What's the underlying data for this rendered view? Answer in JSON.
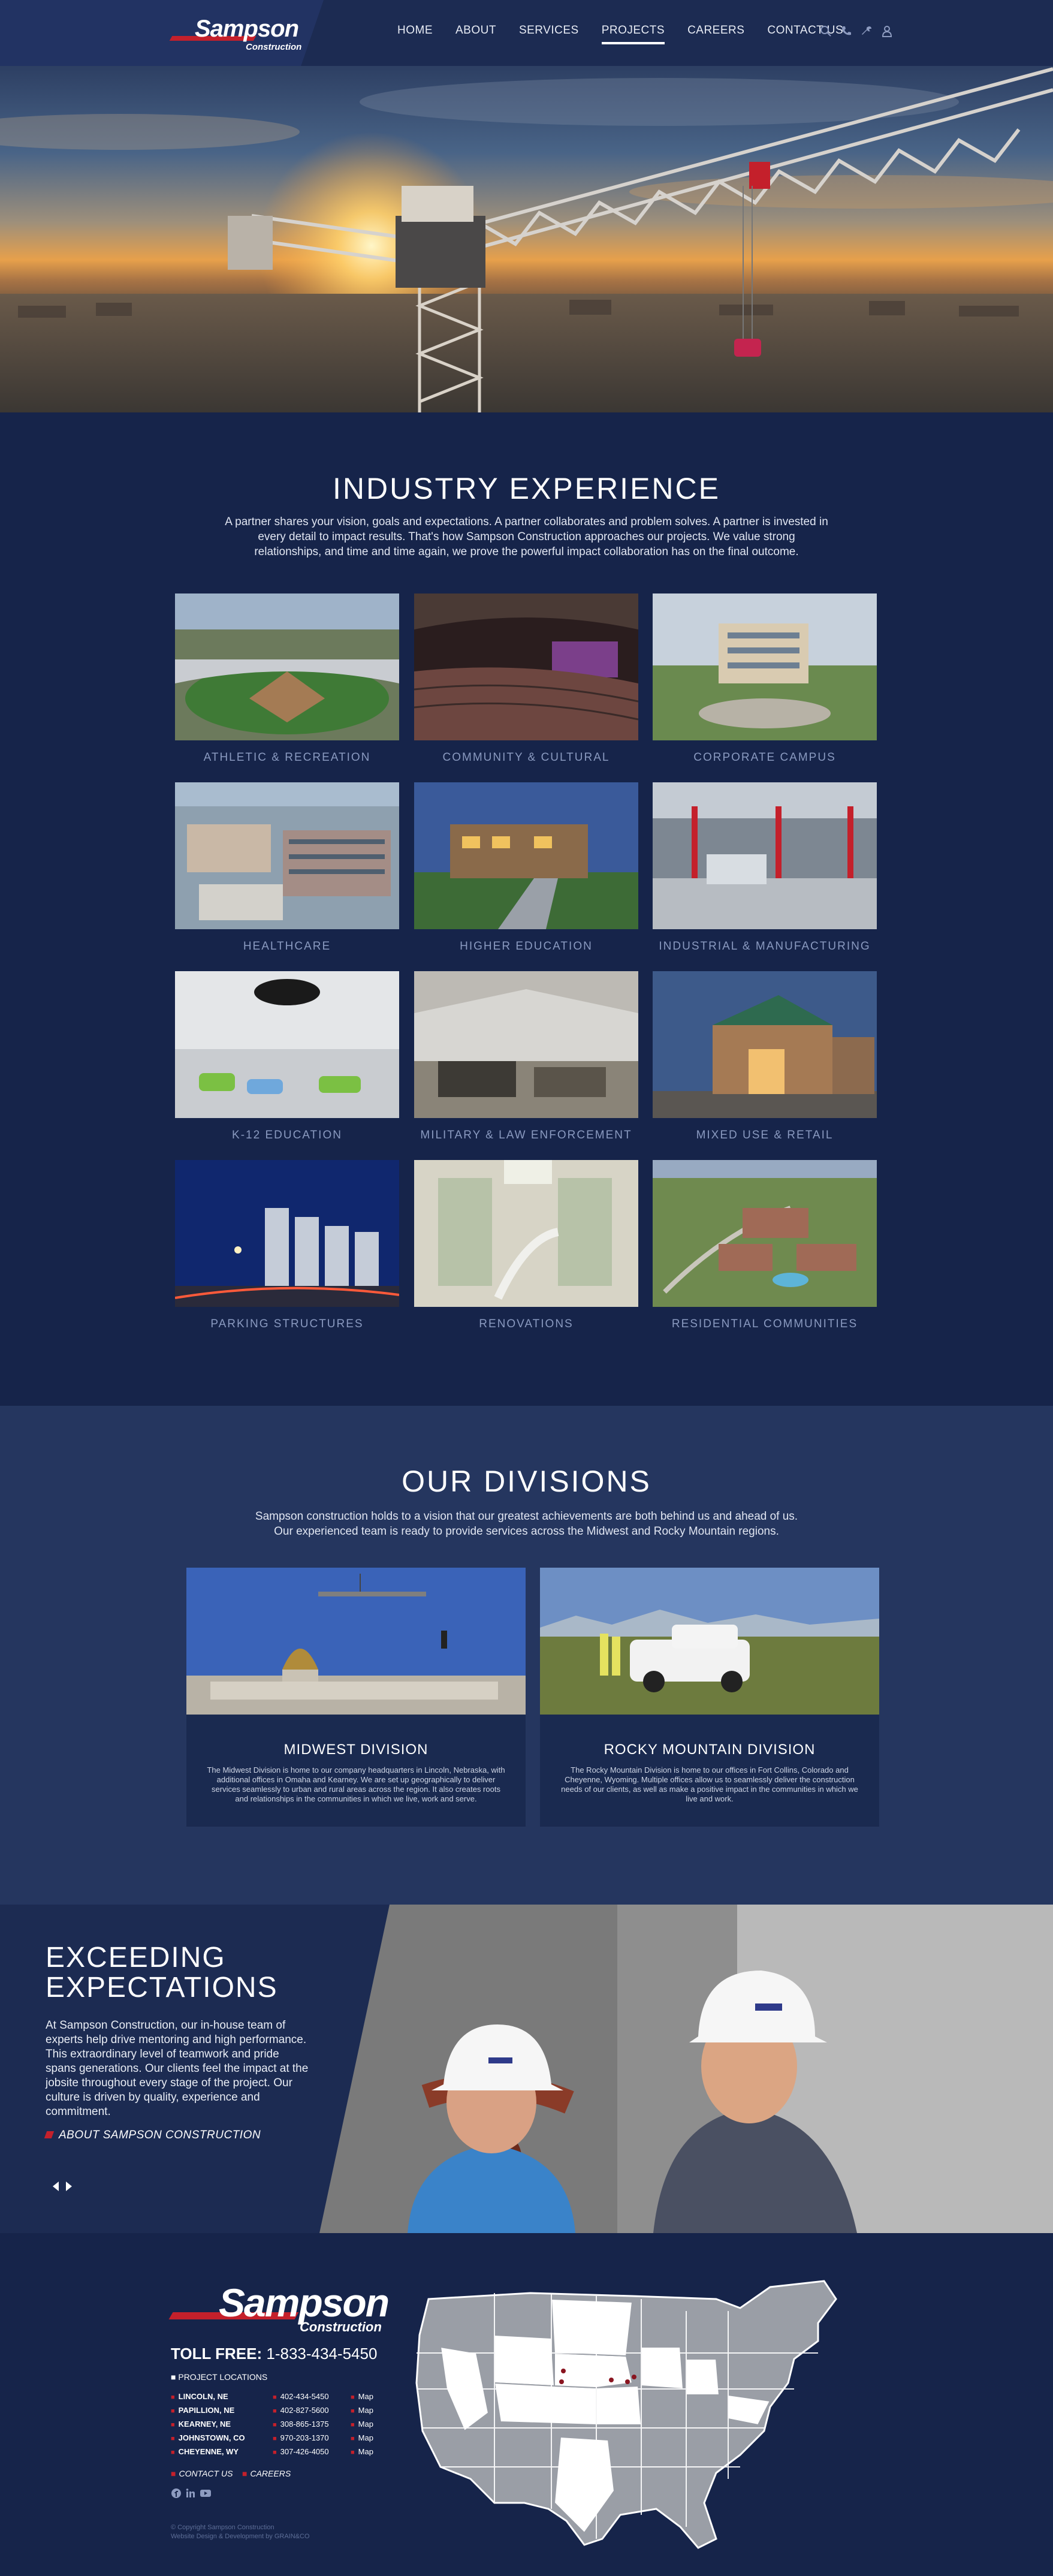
{
  "brand": {
    "name": "Sampson",
    "sub": "Construction",
    "accent": "#c4202b",
    "navy": "#16244a"
  },
  "nav": {
    "items": [
      {
        "label": "HOME"
      },
      {
        "label": "ABOUT"
      },
      {
        "label": "SERVICES"
      },
      {
        "label": "PROJECTS",
        "active": true
      },
      {
        "label": "CAREERS"
      },
      {
        "label": "CONTACT US"
      }
    ],
    "icons": [
      "search-icon",
      "phone-icon",
      "wrench-icon",
      "user-icon"
    ]
  },
  "industry": {
    "title": "INDUSTRY EXPERIENCE",
    "description": "A partner shares your vision, goals and expectations. A partner collaborates and problem solves. A partner is invested in every detail to impact results. That's how Sampson Construction approaches our projects. We value strong relationships, and time and time again, we prove the powerful impact collaboration has on the final outcome.",
    "categories": [
      {
        "label": "ATHLETIC & RECREATION"
      },
      {
        "label": "COMMUNITY & CULTURAL"
      },
      {
        "label": "CORPORATE CAMPUS"
      },
      {
        "label": "HEALTHCARE"
      },
      {
        "label": "HIGHER EDUCATION"
      },
      {
        "label": "INDUSTRIAL & MANUFACTURING"
      },
      {
        "label": "K-12 EDUCATION"
      },
      {
        "label": "MILITARY & LAW ENFORCEMENT"
      },
      {
        "label": "MIXED USE & RETAIL"
      },
      {
        "label": "PARKING STRUCTURES"
      },
      {
        "label": "RENOVATIONS"
      },
      {
        "label": "RESIDENTIAL COMMUNITIES"
      }
    ]
  },
  "divisions": {
    "title": "OUR DIVISIONS",
    "description_line1": "Sampson construction holds to a vision that our greatest achievements are both behind us and ahead of us.",
    "description_line2": "Our experienced team is ready to provide services across the Midwest and Rocky Mountain regions.",
    "items": [
      {
        "title": "MIDWEST DIVISION",
        "text": "The Midwest Division is home to our company headquarters in Lincoln, Nebraska, with additional offices in Omaha and Kearney. We are set up geographically to deliver services seamlessly to urban and rural areas across the region. It also creates roots and relationships in the communities in which we live, work and serve."
      },
      {
        "title": "ROCKY MOUNTAIN DIVISION",
        "text": "The Rocky Mountain Division is home to our offices in Fort Collins, Colorado and Cheyenne, Wyoming. Multiple offices allow us to seamlessly deliver the construction needs of our clients, as well as make a positive impact in the communities in which we live and work."
      }
    ]
  },
  "exceed": {
    "title_line1": "EXCEEDING",
    "title_line2": "EXPECTATIONS",
    "text": "At Sampson Construction, our in-house team of experts help drive mentoring and high performance. This extraordinary level of teamwork and pride spans generations. Our clients feel the impact at the jobsite throughout every stage of the project. Our culture is driven by quality, experience and commitment.",
    "link": "ABOUT SAMPSON CONSTRUCTION"
  },
  "footer": {
    "toll_label": "TOLL FREE:",
    "toll_number": "1-833-434-5450",
    "locations_heading": "PROJECT LOCATIONS",
    "locations": [
      {
        "city": "LINCOLN, NE",
        "phone": "402-434-5450",
        "map": "Map"
      },
      {
        "city": "PAPILLION, NE",
        "phone": "402-827-5600",
        "map": "Map"
      },
      {
        "city": "KEARNEY, NE",
        "phone": "308-865-1375",
        "map": "Map"
      },
      {
        "city": "JOHNSTOWN, CO",
        "phone": "970-203-1370",
        "map": "Map"
      },
      {
        "city": "CHEYENNE, WY",
        "phone": "307-426-4050",
        "map": "Map"
      }
    ],
    "link_contact": "CONTACT US",
    "link_careers": "CAREERS",
    "social": [
      "facebook-icon",
      "linkedin-icon",
      "youtube-icon"
    ],
    "copyright": "© Copyright Sampson Construction",
    "credit": "Website Design & Development by GRAIN&CO"
  }
}
